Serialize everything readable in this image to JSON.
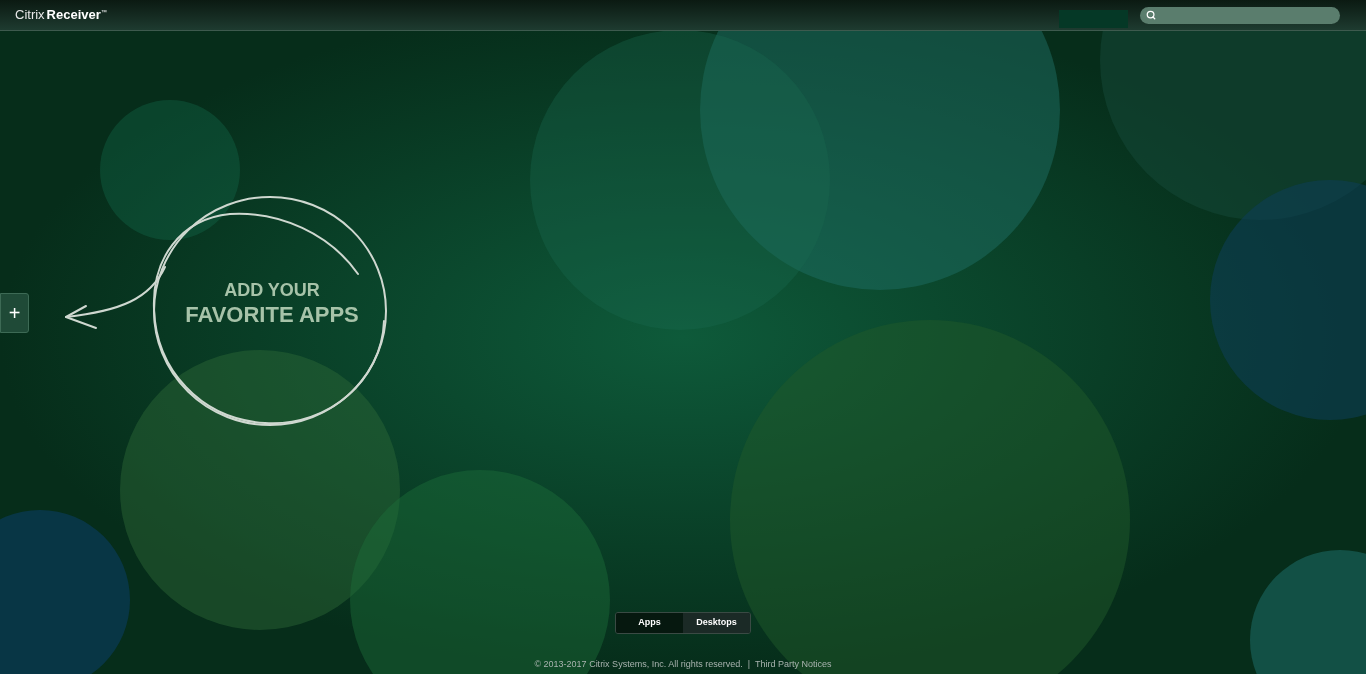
{
  "header": {
    "logo": {
      "brand": "Citrix",
      "product": "Receiver",
      "mark": "™"
    }
  },
  "hint": {
    "add_button": "+",
    "line_1": "ADD YOUR",
    "line_2": "FAVORITE APPS"
  },
  "tabs": [
    {
      "label": "Apps",
      "selected": true
    },
    {
      "label": "Desktops",
      "selected": false
    }
  ],
  "footer": {
    "copyright": "© 2013-2017 Citrix Systems, Inc. All rights reserved.",
    "separator": "|",
    "link": "Third Party Notices"
  }
}
